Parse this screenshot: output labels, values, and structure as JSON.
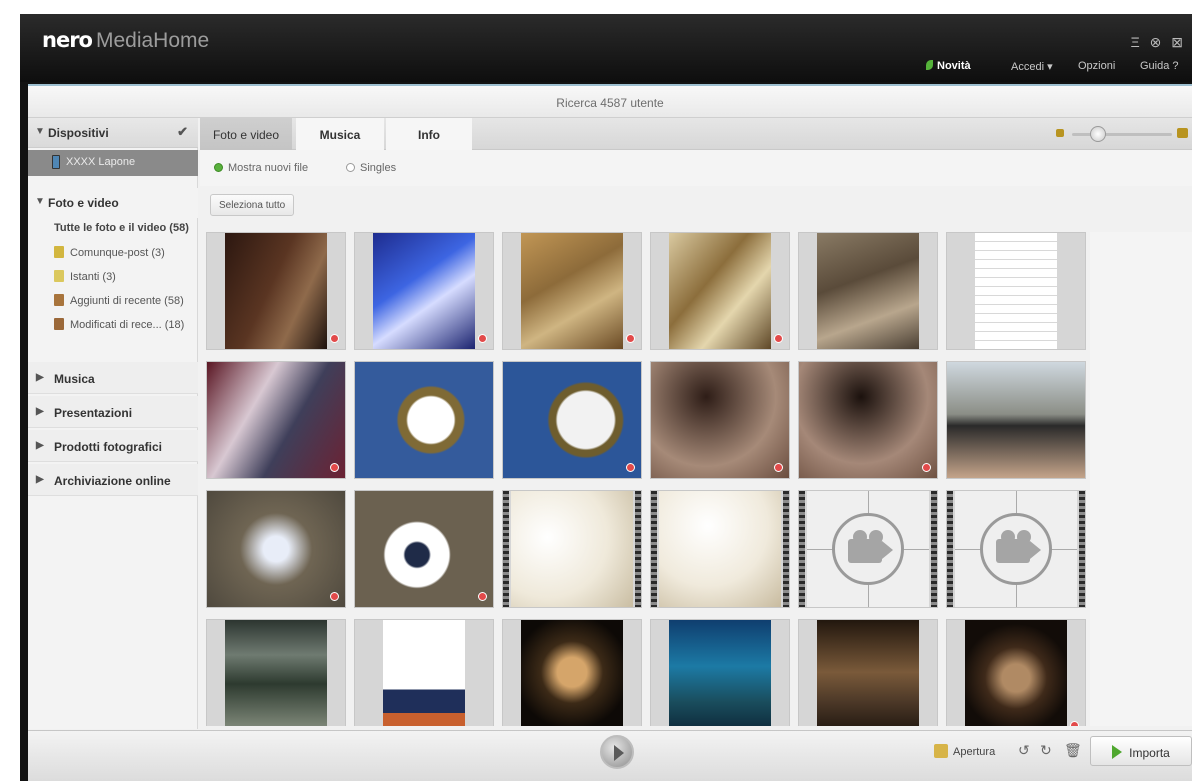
{
  "app": {
    "brand": "nero",
    "product": "MediaHome",
    "window_controls": "Ξ ⊗ ⊠"
  },
  "top_nav": {
    "news": "Novità",
    "access": "Accedi ▾",
    "options": "Opzioni",
    "help": "Guida ?"
  },
  "search": {
    "text": "Ricerca 4587 utente"
  },
  "sidebar": {
    "devices_header": "Dispositivi",
    "device_item": "XXXX Lapone",
    "photos_header": "Foto e video",
    "all_photos": "Tutte le foto e il video (58)",
    "folders": [
      {
        "label": "Comunque-post (3)",
        "color": "#d2b63f"
      },
      {
        "label": "Istanti (3)",
        "color": "#dbc85d"
      },
      {
        "label": "Aggiunti di recente (58)",
        "color": "#a8743c"
      },
      {
        "label": "Modificati di rece... (18)",
        "color": "#9b6839"
      }
    ],
    "sections": [
      "Musica",
      "Presentazioni",
      "Prodotti fotografici",
      "Archiviazione online"
    ]
  },
  "tabs": [
    "Foto e video",
    "Musica",
    "Info"
  ],
  "filters": {
    "new_files": "Mostra nuovi file",
    "singles": "Singles"
  },
  "toolbar": {
    "select_all": "Seleziona tutto"
  },
  "photos": [
    {
      "type": "photo",
      "bg": "linear-gradient(115deg,#2c1710,#5a3522 45%,#8f6a4b 70%,#1e120d)",
      "marked": true
    },
    {
      "type": "photo",
      "bg": "linear-gradient(145deg,#1e2c8f,#3d65e2 40%,#d6dcff 60%,#1b236f)",
      "marked": true
    },
    {
      "type": "photo",
      "bg": "linear-gradient(150deg,#c19655,#8d6b3a 40%,#cfb582 65%,#6a4a24)",
      "marked": true
    },
    {
      "type": "photo",
      "bg": "linear-gradient(130deg,#d9c9a0,#8c6e3c 40%,#e4d6ad 65%,#5e4727)",
      "marked": true
    },
    {
      "type": "photo",
      "bg": "linear-gradient(160deg,#897a64,#5a4b3a 40%,#b8a68d 70%,#4a3f33)",
      "marked": false
    },
    {
      "type": "doc",
      "bg": "repeating-linear-gradient(#ffffff 0 8px,#d8d8d8 8px 9px)",
      "marked": false
    },
    {
      "type": "photo",
      "bg": "linear-gradient(120deg,#5a1623,#d8c8d2 35%,#3f3f5a 60%,#6c2233)",
      "marked": true
    },
    {
      "type": "photo",
      "bg": "radial-gradient(circle at 55% 50%,#ffffff 0 24%,#7f6a36 26% 34%,#345b9c 36%)",
      "marked": false
    },
    {
      "type": "photo",
      "bg": "radial-gradient(circle at 60% 50%,#f2f2f2 0 28%,#6e5d2e 30% 36%,#2c5699 38%)",
      "marked": true
    },
    {
      "type": "photo",
      "bg": "radial-gradient(circle at 40% 30%,#2e1d17,#a68a78 60%,#6a4d3f)",
      "marked": true
    },
    {
      "type": "photo",
      "bg": "radial-gradient(circle at 45% 30%,#1b110d,#a58878 60%,#6f5243)",
      "marked": true
    },
    {
      "type": "photo",
      "bg": "linear-gradient(180deg,#cfd8df,#8b8e86 45%,#2a2a2a 55%,#c4a48a)",
      "marked": false
    },
    {
      "type": "photo",
      "bg": "radial-gradient(circle at 50% 50%,#e8edf8 0 14%,#6f6553 40%,#4f493e)",
      "marked": true
    },
    {
      "type": "photo",
      "bg": "radial-gradient(circle at 45% 55%,#1f2b48 0 12%,#ffffff 14% 32%,#6b6150 34%)",
      "marked": true
    },
    {
      "type": "blank",
      "bg": "radial-gradient(circle at 30% 40%,#ffffff,#efe9da 55%,#c9bda2)",
      "marked": false
    },
    {
      "type": "blank",
      "bg": "radial-gradient(circle at 40% 30%,#ffffff,#f0eadc 55%,#c8bb9f)",
      "marked": false
    },
    {
      "type": "camera",
      "bg": "#efefef",
      "marked": false
    },
    {
      "type": "camera",
      "bg": "#efefef",
      "marked": false
    },
    {
      "type": "photo",
      "bg": "linear-gradient(180deg,#2c3530,#6f7b71 30%,#2d3a2f 55%,#8e9787)",
      "marked": false
    },
    {
      "type": "doc",
      "bg": "linear-gradient(180deg,#ffffff 0 60%,#1f2f5a 60% 80%,#c8602e 80%)",
      "marked": false
    },
    {
      "type": "photo",
      "bg": "radial-gradient(circle at 50% 45%,#d5a56a 0 18%,#3c2a17 38%,#0d0906 70%)",
      "marked": false
    },
    {
      "type": "photo",
      "bg": "linear-gradient(180deg,#0f3e6f,#1c7aa5 40%,#1a4e5e 70%,#0b2334)",
      "marked": false
    },
    {
      "type": "photo",
      "bg": "linear-gradient(180deg,#22170e,#7a5a3a 45%,#4d3928 70%,#1a120c)",
      "marked": false
    },
    {
      "type": "photo",
      "bg": "radial-gradient(circle at 50% 50%,#b08a64 0 18%,#3f2a1a 40%,#120c08 70%)",
      "marked": true
    }
  ],
  "bottom": {
    "open": "Apertura",
    "import": "Importa"
  }
}
